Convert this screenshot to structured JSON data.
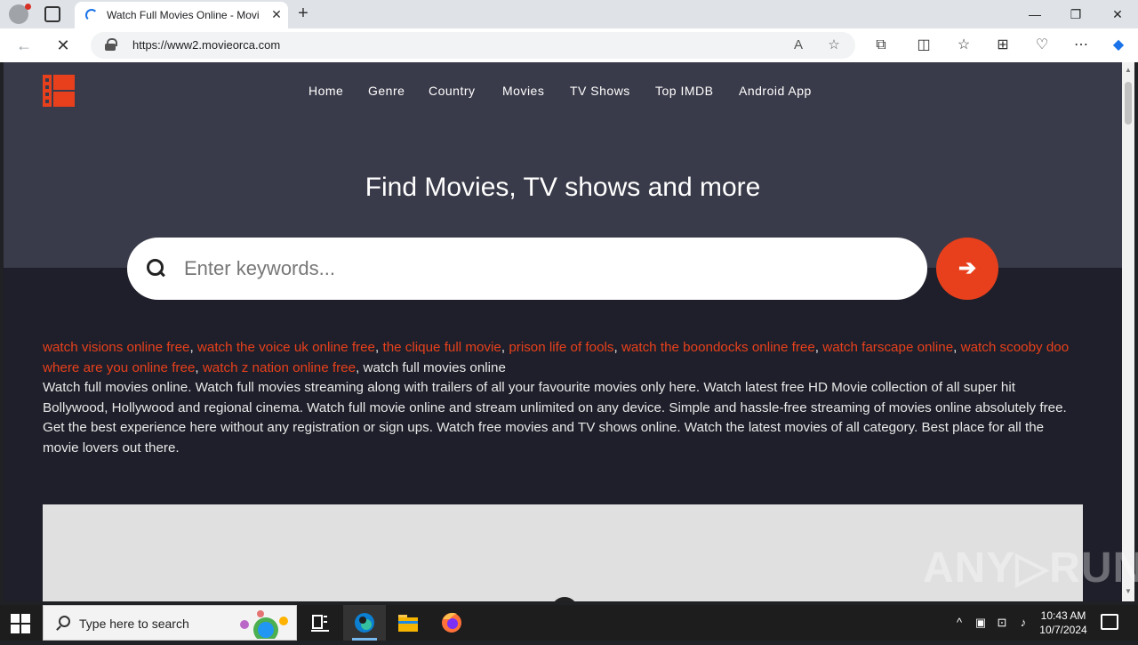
{
  "browser": {
    "tab_title": "Watch Full Movies Online - Movi",
    "tab_close": "✕",
    "new_tab": "+",
    "url": "https://www2.movieorca.com",
    "window": {
      "minimize": "—",
      "restore": "❐",
      "close": "✕"
    }
  },
  "site": {
    "nav": [
      "Home",
      "Genre",
      "Country",
      "Movies",
      "TV Shows",
      "Top IMDB",
      "Android App"
    ],
    "hero_title": "Find Movies, TV shows and more",
    "search": {
      "placeholder": "Enter keywords...",
      "go_label": "➔"
    },
    "keywords": [
      "watch visions online free",
      "watch the voice uk online free",
      "the clique full movie",
      "prison life of fools",
      "watch the boondocks online free",
      "watch farscape online",
      "watch scooby doo where are you online free",
      "watch z nation online free"
    ],
    "keywords_tail": "watch full movies online",
    "description": "Watch full movies online. Watch full movies streaming along with trailers of all your favourite movies only here. Watch latest free HD Movie collection of all super hit Bollywood, Hollywood and regional cinema. Watch full movie online and stream unlimited on any device. Simple and hassle-free streaming of movies online absolutely free. Get the best experience here without any registration or sign ups. Watch free movies and TV shows online. Watch the latest movies of all category. Best place for all the movie lovers out there.",
    "accent_color": "#e8401c",
    "header_bg": "#3a3b4a",
    "body_bg": "#1e1f2a"
  },
  "watermark": "ANY▷RUN",
  "taskbar": {
    "search_placeholder": "Type here to search",
    "time": "10:43 AM",
    "date": "10/7/2024",
    "apps": [
      "task-view-icon",
      "edge-icon",
      "file-explorer-icon",
      "firefox-icon"
    ]
  }
}
